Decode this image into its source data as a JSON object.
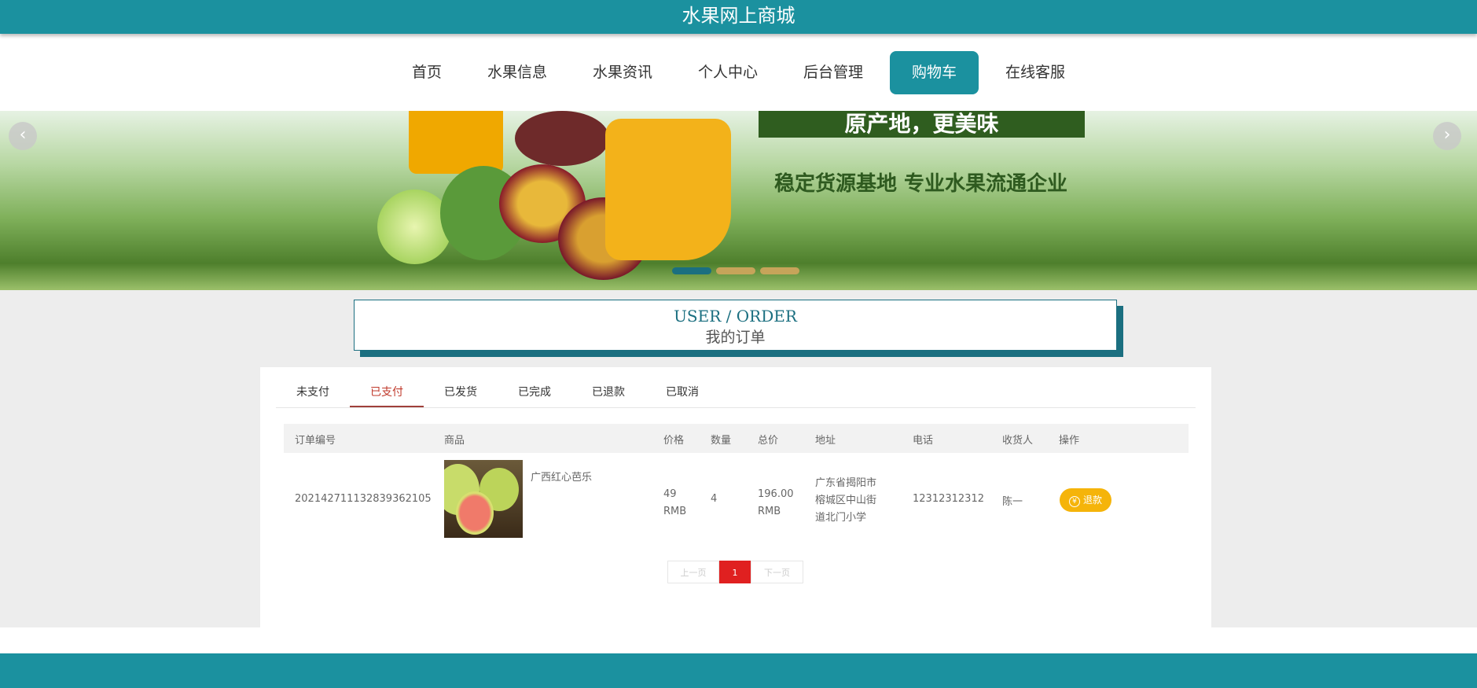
{
  "header": {
    "title": "水果网上商城"
  },
  "nav": {
    "items": [
      {
        "label": "首页"
      },
      {
        "label": "水果信息"
      },
      {
        "label": "水果资讯"
      },
      {
        "label": "个人中心"
      },
      {
        "label": "后台管理"
      },
      {
        "label": "购物车"
      },
      {
        "label": "在线客服"
      }
    ],
    "active_index": 5
  },
  "banner": {
    "slogan_main": "原产地，更美味",
    "slogan_sub": "稳定货源基地 专业水果流通企业",
    "prev_icon": "‹",
    "next_icon": "›"
  },
  "section": {
    "title_en": "USER / ORDER",
    "title_cn": "我的订单"
  },
  "tabs": [
    {
      "label": "未支付"
    },
    {
      "label": "已支付"
    },
    {
      "label": "已发货"
    },
    {
      "label": "已完成"
    },
    {
      "label": "已退款"
    },
    {
      "label": "已取消"
    }
  ],
  "table": {
    "headers": [
      "订单编号",
      "商品",
      "价格",
      "数量",
      "总价",
      "地址",
      "电话",
      "收货人",
      "操作"
    ],
    "rows": [
      {
        "order_no": "202142711132839362105",
        "product": "广西红心芭乐",
        "price": "49",
        "price_unit": "RMB",
        "qty": "4",
        "total": "196.00",
        "total_unit": "RMB",
        "address": [
          "广东省揭阳市",
          "榕城区中山街",
          "道北门小学"
        ],
        "phone": "12312312312",
        "receiver": "陈一",
        "action": "退款",
        "action_icon": "¥"
      }
    ]
  },
  "pagination": {
    "prev": "上一页",
    "current": "1",
    "next": "下一页"
  },
  "colors": {
    "brand": "#1b919f",
    "active_tab": "#c0392b",
    "refund": "#f5b40a",
    "page_current": "#e02020"
  }
}
